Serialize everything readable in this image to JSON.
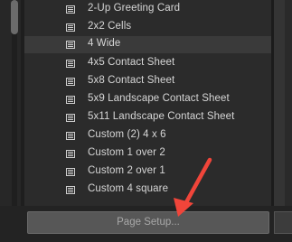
{
  "templates": [
    {
      "label": "2-Up Greeting Card",
      "icon": "template-icon"
    },
    {
      "label": "2x2 Cells",
      "icon": "template-icon"
    },
    {
      "label": "4 Wide",
      "icon": "template-icon",
      "selected": true
    },
    {
      "label": "4x5 Contact Sheet",
      "icon": "template-icon"
    },
    {
      "label": "5x8 Contact Sheet",
      "icon": "template-icon"
    },
    {
      "label": "5x9 Landscape Contact Sheet",
      "icon": "template-icon"
    },
    {
      "label": "5x11 Landscape Contact Sheet",
      "icon": "template-icon"
    },
    {
      "label": "Custom (2) 4 x 6",
      "icon": "template-icon"
    },
    {
      "label": "Custom 1 over 2",
      "icon": "template-icon"
    },
    {
      "label": "Custom 2 over 1",
      "icon": "template-icon"
    },
    {
      "label": "Custom 4 square",
      "icon": "template-icon"
    }
  ],
  "page_setup": {
    "label": "Page Setup..."
  },
  "colors": {
    "annotation_arrow": "#f0453a",
    "panel_bg": "#2b2b2b",
    "highlight_row": "#3a3a3a"
  }
}
